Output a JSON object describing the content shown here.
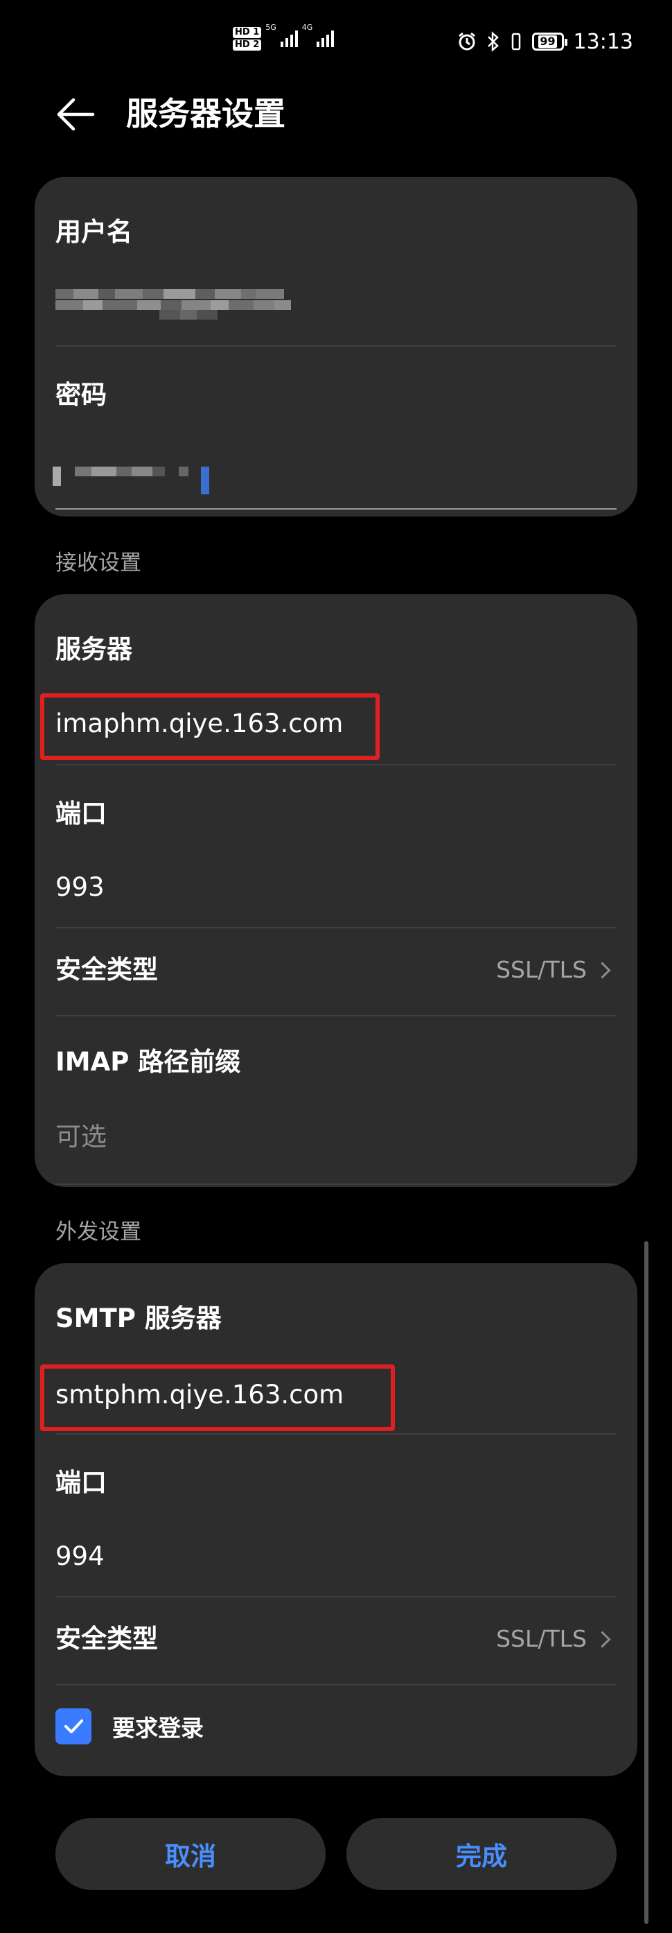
{
  "status_bar": {
    "hd1": "HD 1",
    "hd2": "HD 2",
    "net1": "5G",
    "net2": "4G",
    "battery": "99",
    "time": "13:13"
  },
  "header": {
    "title": "服务器设置",
    "back_icon": "arrow-left-icon"
  },
  "account": {
    "username_label": "用户名",
    "password_label": "密码"
  },
  "incoming": {
    "section_title": "接收设置",
    "server_label": "服务器",
    "server_value": "imaphm.qiye.163.com",
    "port_label": "端口",
    "port_value": "993",
    "security_label": "安全类型",
    "security_value": "SSL/TLS",
    "imap_prefix_label": "IMAP 路径前缀",
    "imap_prefix_placeholder": "可选"
  },
  "outgoing": {
    "section_title": "外发设置",
    "smtp_label": "SMTP 服务器",
    "smtp_value": "smtphm.qiye.163.com",
    "port_label": "端口",
    "port_value": "994",
    "security_label": "安全类型",
    "security_value": "SSL/TLS",
    "require_login_label": "要求登录",
    "require_login_checked": true
  },
  "actions": {
    "cancel_label": "取消",
    "done_label": "完成"
  },
  "colors": {
    "accent": "#4a8eff",
    "checkbox": "#3a7cff",
    "highlight": "#e02020",
    "card": "#2d2d2d"
  }
}
